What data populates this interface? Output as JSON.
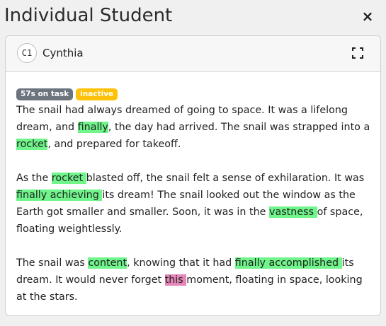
{
  "header": {
    "title": "Individual Student",
    "close_label": "×"
  },
  "student": {
    "initials": "C1",
    "name": "Cynthia"
  },
  "badges": {
    "time_on_task": "57s on task",
    "status": "inactive"
  },
  "colors": {
    "highlight_green": "#6ff58a",
    "highlight_pink": "#e585b8",
    "badge_time": "#6c757d",
    "badge_status": "#ffc107"
  },
  "icons": {
    "close": "close-icon",
    "expand": "expand-icon"
  },
  "paragraphs": [
    [
      {
        "t": "The snail had always dreamed of going to space. It was a lifelong dream, and "
      },
      {
        "t": "finally",
        "h": "green"
      },
      {
        "t": ", the day had arrived. The snail was strapped into a "
      },
      {
        "t": "rocket",
        "h": "green"
      },
      {
        "t": ", and prepared for takeoff."
      }
    ],
    [
      {
        "t": "As the "
      },
      {
        "t": "rocket ",
        "h": "green"
      },
      {
        "t": "blasted off, the snail felt a sense of exhilaration. It was "
      },
      {
        "t": "finally achieving ",
        "h": "green"
      },
      {
        "t": "its dream! The snail looked out the window as the Earth got smaller and smaller. Soon, it was in the "
      },
      {
        "t": "vastness ",
        "h": "green"
      },
      {
        "t": "of space, floating weightlessly."
      }
    ],
    [
      {
        "t": "The snail was "
      },
      {
        "t": "content",
        "h": "green"
      },
      {
        "t": ", knowing that it had "
      },
      {
        "t": "finally accomplished ",
        "h": "green"
      },
      {
        "t": "its dream. It would never forget "
      },
      {
        "t": "this ",
        "h": "pink"
      },
      {
        "t": "moment, floating in space, looking at the stars."
      }
    ]
  ]
}
